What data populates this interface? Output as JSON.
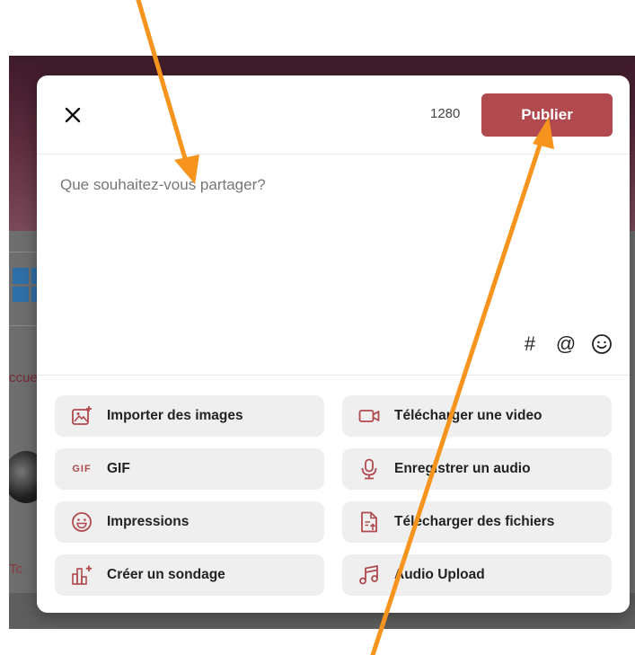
{
  "modal": {
    "char_count": "1280",
    "publish_label": "Publier",
    "placeholder": "Que souhaitez-vous partager?"
  },
  "tools": {
    "hashtag": "#",
    "mention": "@"
  },
  "actions": [
    {
      "label": "Importer des images",
      "icon": "image-upload-icon"
    },
    {
      "label": "Télécharger une video",
      "icon": "video-camera-icon"
    },
    {
      "label": "GIF",
      "icon": "gif-icon",
      "icon_text": "GIF"
    },
    {
      "label": "Enregistrer un audio",
      "icon": "microphone-icon"
    },
    {
      "label": "Impressions",
      "icon": "smiley-icon"
    },
    {
      "label": "Télécharger des fichiers",
      "icon": "file-upload-icon"
    },
    {
      "label": "Créer un sondage",
      "icon": "poll-chart-icon"
    },
    {
      "label": "Audio Upload",
      "icon": "music-note-icon"
    }
  ],
  "background": {
    "side_text_1": "ccue",
    "side_text_2": "Tc"
  },
  "colors": {
    "accent": "#b04a4f",
    "annotation_arrow": "#f7941d",
    "button_bg": "#efefef"
  }
}
